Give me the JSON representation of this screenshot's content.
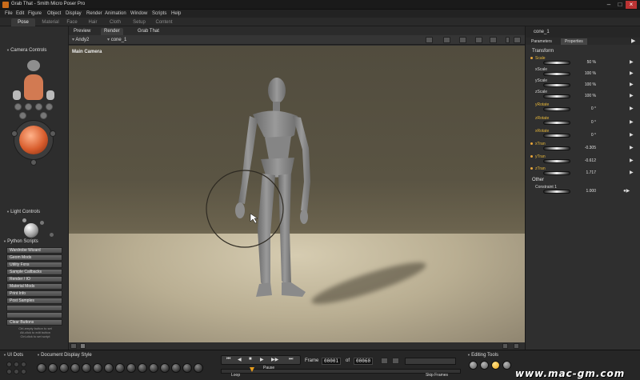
{
  "window": {
    "title": "Grab That - Smith Micro Poser Pro"
  },
  "menu": [
    "File",
    "Edit",
    "Figure",
    "Object",
    "Display",
    "Render",
    "Animation",
    "Window",
    "Scripts",
    "Help"
  ],
  "rooms": [
    "Pose",
    "Material",
    "Face",
    "Hair",
    "Cloth",
    "Setup",
    "Content"
  ],
  "left": {
    "camera_controls": "Camera Controls",
    "light_controls": "Light Controls",
    "python_title": "Python Scripts",
    "python_buttons": [
      "Wardrobe Wizard",
      "Geom Mods",
      "Utility Fxns",
      "Sample Callbacks",
      "Render / IO",
      "Material Mods",
      "Print Info",
      "Post Samples",
      "",
      "",
      "Clear Buttons"
    ],
    "python_hint": [
      "Ctrl-empty button to set",
      "Alt-click to edit button",
      "Ctrl-click to set script"
    ]
  },
  "viewport": {
    "tabs": [
      "Preview",
      "Render",
      "Grab That"
    ],
    "figure_select": "Andy2",
    "actor_select": "cone_1",
    "camera_label": "Main Camera"
  },
  "right": {
    "object": "cone_1",
    "tabs": [
      "Parameters",
      "Properties"
    ],
    "groups": {
      "transform": "Transform",
      "other": "Other"
    },
    "params": [
      {
        "name": "Scale",
        "value": "50 %",
        "hl": true
      },
      {
        "name": "xScale",
        "value": "100 %",
        "hl": false
      },
      {
        "name": "yScale",
        "value": "100 %",
        "hl": false
      },
      {
        "name": "zScale",
        "value": "100 %",
        "hl": false
      },
      {
        "name": "yRotate",
        "value": "0 °",
        "hl": true
      },
      {
        "name": "zRotate",
        "value": "0 °",
        "hl": true
      },
      {
        "name": "xRotate",
        "value": "0 °",
        "hl": true
      },
      {
        "name": "xTran",
        "value": "-0.305",
        "hl": true
      },
      {
        "name": "yTran",
        "value": "-0.612",
        "hl": true
      },
      {
        "name": "zTran",
        "value": "1.717",
        "hl": true
      }
    ],
    "other_params": [
      {
        "name": "Constraint 1",
        "value": "1.000"
      }
    ]
  },
  "bottom": {
    "ui_dots": "UI Dots",
    "doc_display": "Document Display Style",
    "frame_label": "Frame",
    "frame_value": "00001",
    "of_label": "of",
    "frame_total": "00060",
    "loop": "Loop",
    "pause": "Pause",
    "skip_frames": "Skip Frames",
    "editing_tools": "Editing Tools"
  },
  "watermark": "www.mac-gm.com"
}
